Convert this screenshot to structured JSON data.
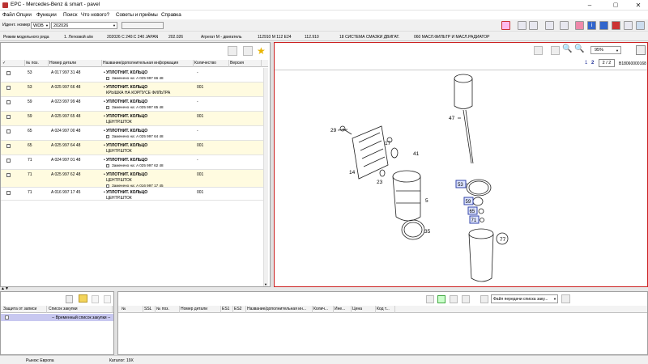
{
  "window": {
    "title": "EPC - Mercedes-Benz & smart - pavel",
    "min": "–",
    "max": "▢",
    "close": "✕"
  },
  "menu": [
    "Файл",
    "Опции",
    "Функции",
    "Поиск",
    "Что нового?",
    "Советы и приёмы",
    "Справка"
  ],
  "ident": {
    "label": "Идент. номер",
    "type_value": "WDB",
    "number_value": "202026"
  },
  "breadcrumb": [
    "Режим модельного ряда",
    "1. Легковой а/м",
    "202026 C 240:C 240 JAPAN",
    "202.026",
    "Агрегат М - двигатель",
    "112910 M 112 E24",
    "112.910",
    "18 СИСТЕМА СМАЗКИ ДВИГАТ.",
    "060 МАСЛ.ФИЛЬТР И МАСЛ.РАДИАТОР"
  ],
  "grid": {
    "headers": [
      "✓",
      "№ поз.",
      "Номер детали",
      "Название/дополнительная информация",
      "Количество",
      "Версия"
    ],
    "rows": [
      {
        "pos": "53",
        "part": "A 017 997 31 48",
        "name": "УПЛОТНИТ. КОЛЬЦО",
        "note": "Заменено на: A 025 997 66 48",
        "extra": "",
        "qty": "-",
        "hl": false
      },
      {
        "pos": "53",
        "part": "A 025 997 66 48",
        "name": "УПЛОТНИТ. КОЛЬЦО",
        "note": "",
        "extra": "КРЫШКА НА КОРПУСЕ ФИЛЬТРА",
        "qty": "001",
        "hl": true
      },
      {
        "pos": "59",
        "part": "A 023 997 99 48",
        "name": "УПЛОТНИТ. КОЛЬЦО",
        "note": "Заменено на: A 025 997 65 48",
        "extra": "",
        "qty": "-",
        "hl": false
      },
      {
        "pos": "59",
        "part": "A 025 997 65 48",
        "name": "УПЛОТНИТ. КОЛЬЦО",
        "note": "",
        "extra": "ЦЕНТР.ШТОК",
        "qty": "001",
        "hl": true
      },
      {
        "pos": "65",
        "part": "A 024 997 00 48",
        "name": "УПЛОТНИТ. КОЛЬЦО",
        "note": "Заменено на: A 025 997 64 48",
        "extra": "",
        "qty": "-",
        "hl": false
      },
      {
        "pos": "65",
        "part": "A 025 997 64 48",
        "name": "УПЛОТНИТ. КОЛЬЦО",
        "note": "",
        "extra": "ЦЕНТР.ШТОК",
        "qty": "001",
        "hl": true
      },
      {
        "pos": "71",
        "part": "A 024 997 01 48",
        "name": "УПЛОТНИТ. КОЛЬЦО",
        "note": "Заменено на: A 025 997 62 48",
        "extra": "",
        "qty": "-",
        "hl": false
      },
      {
        "pos": "71",
        "part": "A 025 997 62 48",
        "name": "УПЛОТНИТ. КОЛЬЦО",
        "note": "Заменено на: A 016 997 17 45",
        "extra": "ЦЕНТР.ШТОК",
        "qty": "001",
        "hl": true
      },
      {
        "pos": "71",
        "part": "A 016 997 17 45",
        "name": "УПЛОТНИТ. КОЛЬЦО",
        "note": "",
        "extra": "ЦЕНТР.ШТОК",
        "qty": "001",
        "hl": false
      }
    ]
  },
  "viewer": {
    "page1": "1",
    "page2": "2",
    "page_of": "2 / 2",
    "zoom": "95%",
    "image_id": "B18060000168"
  },
  "callouts": {
    "c29": "29",
    "c17": "17",
    "c41": "41",
    "c14": "14",
    "c23": "23",
    "c5": "5",
    "c35": "35",
    "c47": "47",
    "c53": "53",
    "c59": "59",
    "c65": "65",
    "c71": "71",
    "c77": "77"
  },
  "bottom_left": {
    "headers": [
      "Защита от записи",
      "Список закупки"
    ],
    "row": "-- Временный список закупки --"
  },
  "bottom_right": {
    "transfer_placeholder": "Файл передачи списка заку...",
    "headers": [
      "№",
      "SSL",
      "№ поз.",
      "Номер детали",
      "ES1",
      "ES2",
      "Название/дополнительная ин...",
      "Колич...",
      "Ине...",
      "Цена",
      "Код т..."
    ]
  },
  "status": {
    "market": "Рынок: Европа",
    "catalog": "Каталог: 19X"
  },
  "colors": {
    "highlight_row": "#fffbe0",
    "selected_border": "#cc2222",
    "callout_box": "#3344aa",
    "list_selected": "#c8c8f0"
  }
}
